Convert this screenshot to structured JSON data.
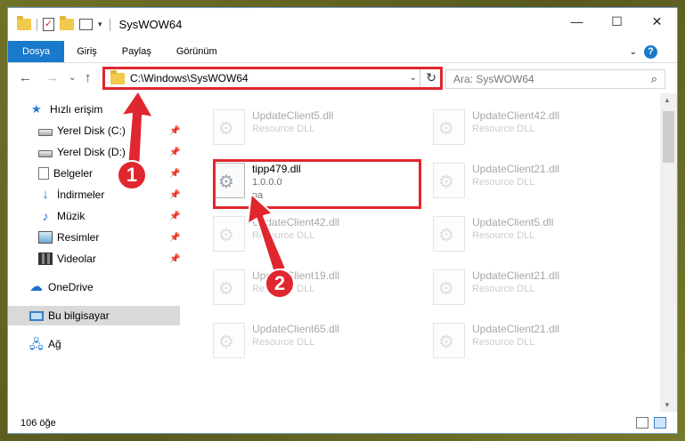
{
  "window": {
    "title": "SysWOW64",
    "controls": {
      "minimize": "—",
      "maximize": "☐",
      "close": "✕"
    }
  },
  "ribbon": {
    "tabs": [
      "Dosya",
      "Giriş",
      "Paylaş",
      "Görünüm"
    ],
    "expand": "⌄",
    "help": "?"
  },
  "nav": {
    "back": "←",
    "forward": "→",
    "recent": "⌄",
    "up": "↑",
    "address": "C:\\Windows\\SysWOW64",
    "search_placeholder": "Ara: SysWOW64"
  },
  "sidebar": {
    "items": [
      {
        "label": "Hızlı erişim",
        "icon": "star-icon"
      },
      {
        "label": "Yerel Disk (C:)",
        "icon": "drive-icon",
        "pinned": true
      },
      {
        "label": "Yerel Disk (D:)",
        "icon": "drive-icon",
        "pinned": true
      },
      {
        "label": "Belgeler",
        "icon": "documents-icon",
        "pinned": true
      },
      {
        "label": "İndirmeler",
        "icon": "downloads-icon",
        "pinned": true
      },
      {
        "label": "Müzik",
        "icon": "music-icon",
        "pinned": true
      },
      {
        "label": "Resimler",
        "icon": "pictures-icon",
        "pinned": true
      },
      {
        "label": "Videolar",
        "icon": "videos-icon",
        "pinned": true
      },
      {
        "label": "OneDrive",
        "icon": "onedrive-icon"
      },
      {
        "label": "Bu bilgisayar",
        "icon": "this-pc-icon",
        "selected": true
      },
      {
        "label": "Ağ",
        "icon": "network-icon"
      }
    ]
  },
  "files": [
    {
      "name": "UpdateClient5.dll",
      "desc": "Resource DLL",
      "faded": true
    },
    {
      "name": "UpdateClient42.dll",
      "desc": "Resource DLL",
      "faded": true
    },
    {
      "name": "tipp479.dll",
      "desc": "1.0.0.0",
      "desc2": "na",
      "faded": false
    },
    {
      "name": "UpdateClient21.dll",
      "desc": "Resource DLL",
      "faded": true
    },
    {
      "name": "UpdateClient42.dll",
      "desc": "Resource DLL",
      "faded": true
    },
    {
      "name": "UpdateClient5.dll",
      "desc": "Resource DLL",
      "faded": true
    },
    {
      "name": "UpdateClient19.dll",
      "desc": "Resource DLL",
      "faded": true
    },
    {
      "name": "UpdateClient21.dll",
      "desc": "Resource DLL",
      "faded": true
    },
    {
      "name": "UpdateClient65.dll",
      "desc": "Resource DLL",
      "faded": true
    },
    {
      "name": "UpdateClient21.dll",
      "desc": "Resource DLL",
      "faded": true
    }
  ],
  "status": {
    "count": "106 öğe"
  },
  "annotations": {
    "step1": "1",
    "step2": "2"
  },
  "colors": {
    "highlight": "#e0262e",
    "accent": "#1979ca"
  }
}
